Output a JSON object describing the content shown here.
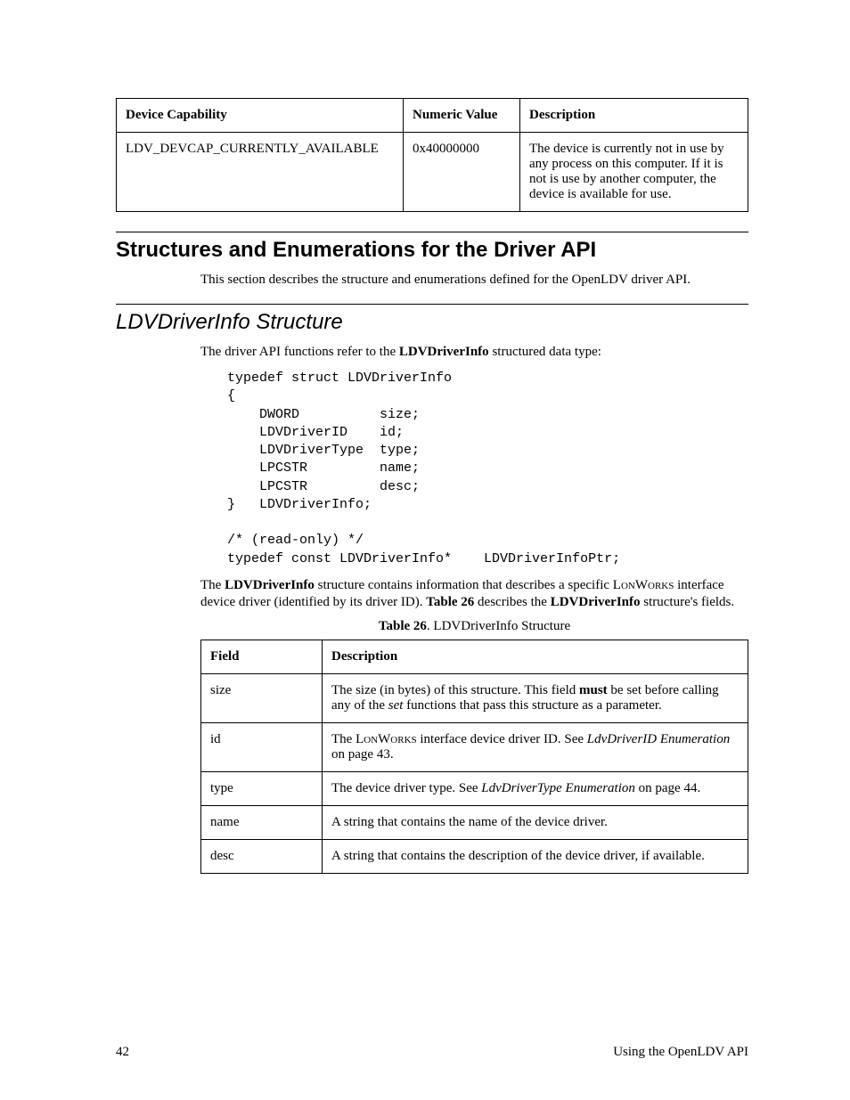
{
  "table1": {
    "headers": [
      "Device Capability",
      "Numeric Value",
      "Description"
    ],
    "row": {
      "cap": "LDV_DEVCAP_CURRENTLY_AVAILABLE",
      "val": "0x40000000",
      "desc": "The device is currently not in use by any process on this computer.  If it is not is use by another computer, the device is available for use."
    }
  },
  "section1": {
    "title": "Structures and Enumerations for the Driver API",
    "para": "This section describes the structure and enumerations defined for the OpenLDV driver API."
  },
  "section2": {
    "title": "LDVDriverInfo Structure",
    "intro_pre": "The driver API functions refer to the ",
    "intro_bold": "LDVDriverInfo",
    "intro_post": " structured data type:",
    "code": "typedef struct LDVDriverInfo\n{\n    DWORD          size;\n    LDVDriverID    id;\n    LDVDriverType  type;\n    LPCSTR         name;\n    LPCSTR         desc;\n}   LDVDriverInfo;\n\n/* (read-only) */\ntypedef const LDVDriverInfo*    LDVDriverInfoPtr;",
    "p2": {
      "a": "The ",
      "b1": "LDVDriverInfo",
      "c": " structure contains information that describes a specific ",
      "sc": "LonWorks",
      "d": " interface device driver (identified by its driver ID).  ",
      "b2": "Table 26",
      "e": " describes the ",
      "b3": "LDVDriverInfo",
      "f": " structure's fields."
    },
    "caption_b": "Table 26",
    "caption_r": ". LDVDriverInfo Structure"
  },
  "table2": {
    "headers": [
      "Field",
      "Description"
    ],
    "rows": {
      "size": {
        "f": "size",
        "d_a": "The size (in bytes) of this structure.  This field ",
        "d_b1": "must",
        "d_b": " be set before calling any of the ",
        "d_i": "set",
        "d_c": " functions that pass this structure as a parameter."
      },
      "id": {
        "f": "id",
        "d_a": "The ",
        "d_sc": "LonWorks",
        "d_b": " interface device driver ID.  See ",
        "d_i": "LdvDriverID Enumeration",
        "d_c": " on page 43."
      },
      "type": {
        "f": "type",
        "d_a": "The device driver type.  See ",
        "d_i": "LdvDriverType Enumeration",
        "d_c": " on page 44."
      },
      "name": {
        "f": "name",
        "d": "A string that contains the name of the device driver."
      },
      "desc": {
        "f": "desc",
        "d": "A string that contains the description of the device driver, if available."
      }
    }
  },
  "footer": {
    "left": "42",
    "right": "Using the OpenLDV API"
  }
}
